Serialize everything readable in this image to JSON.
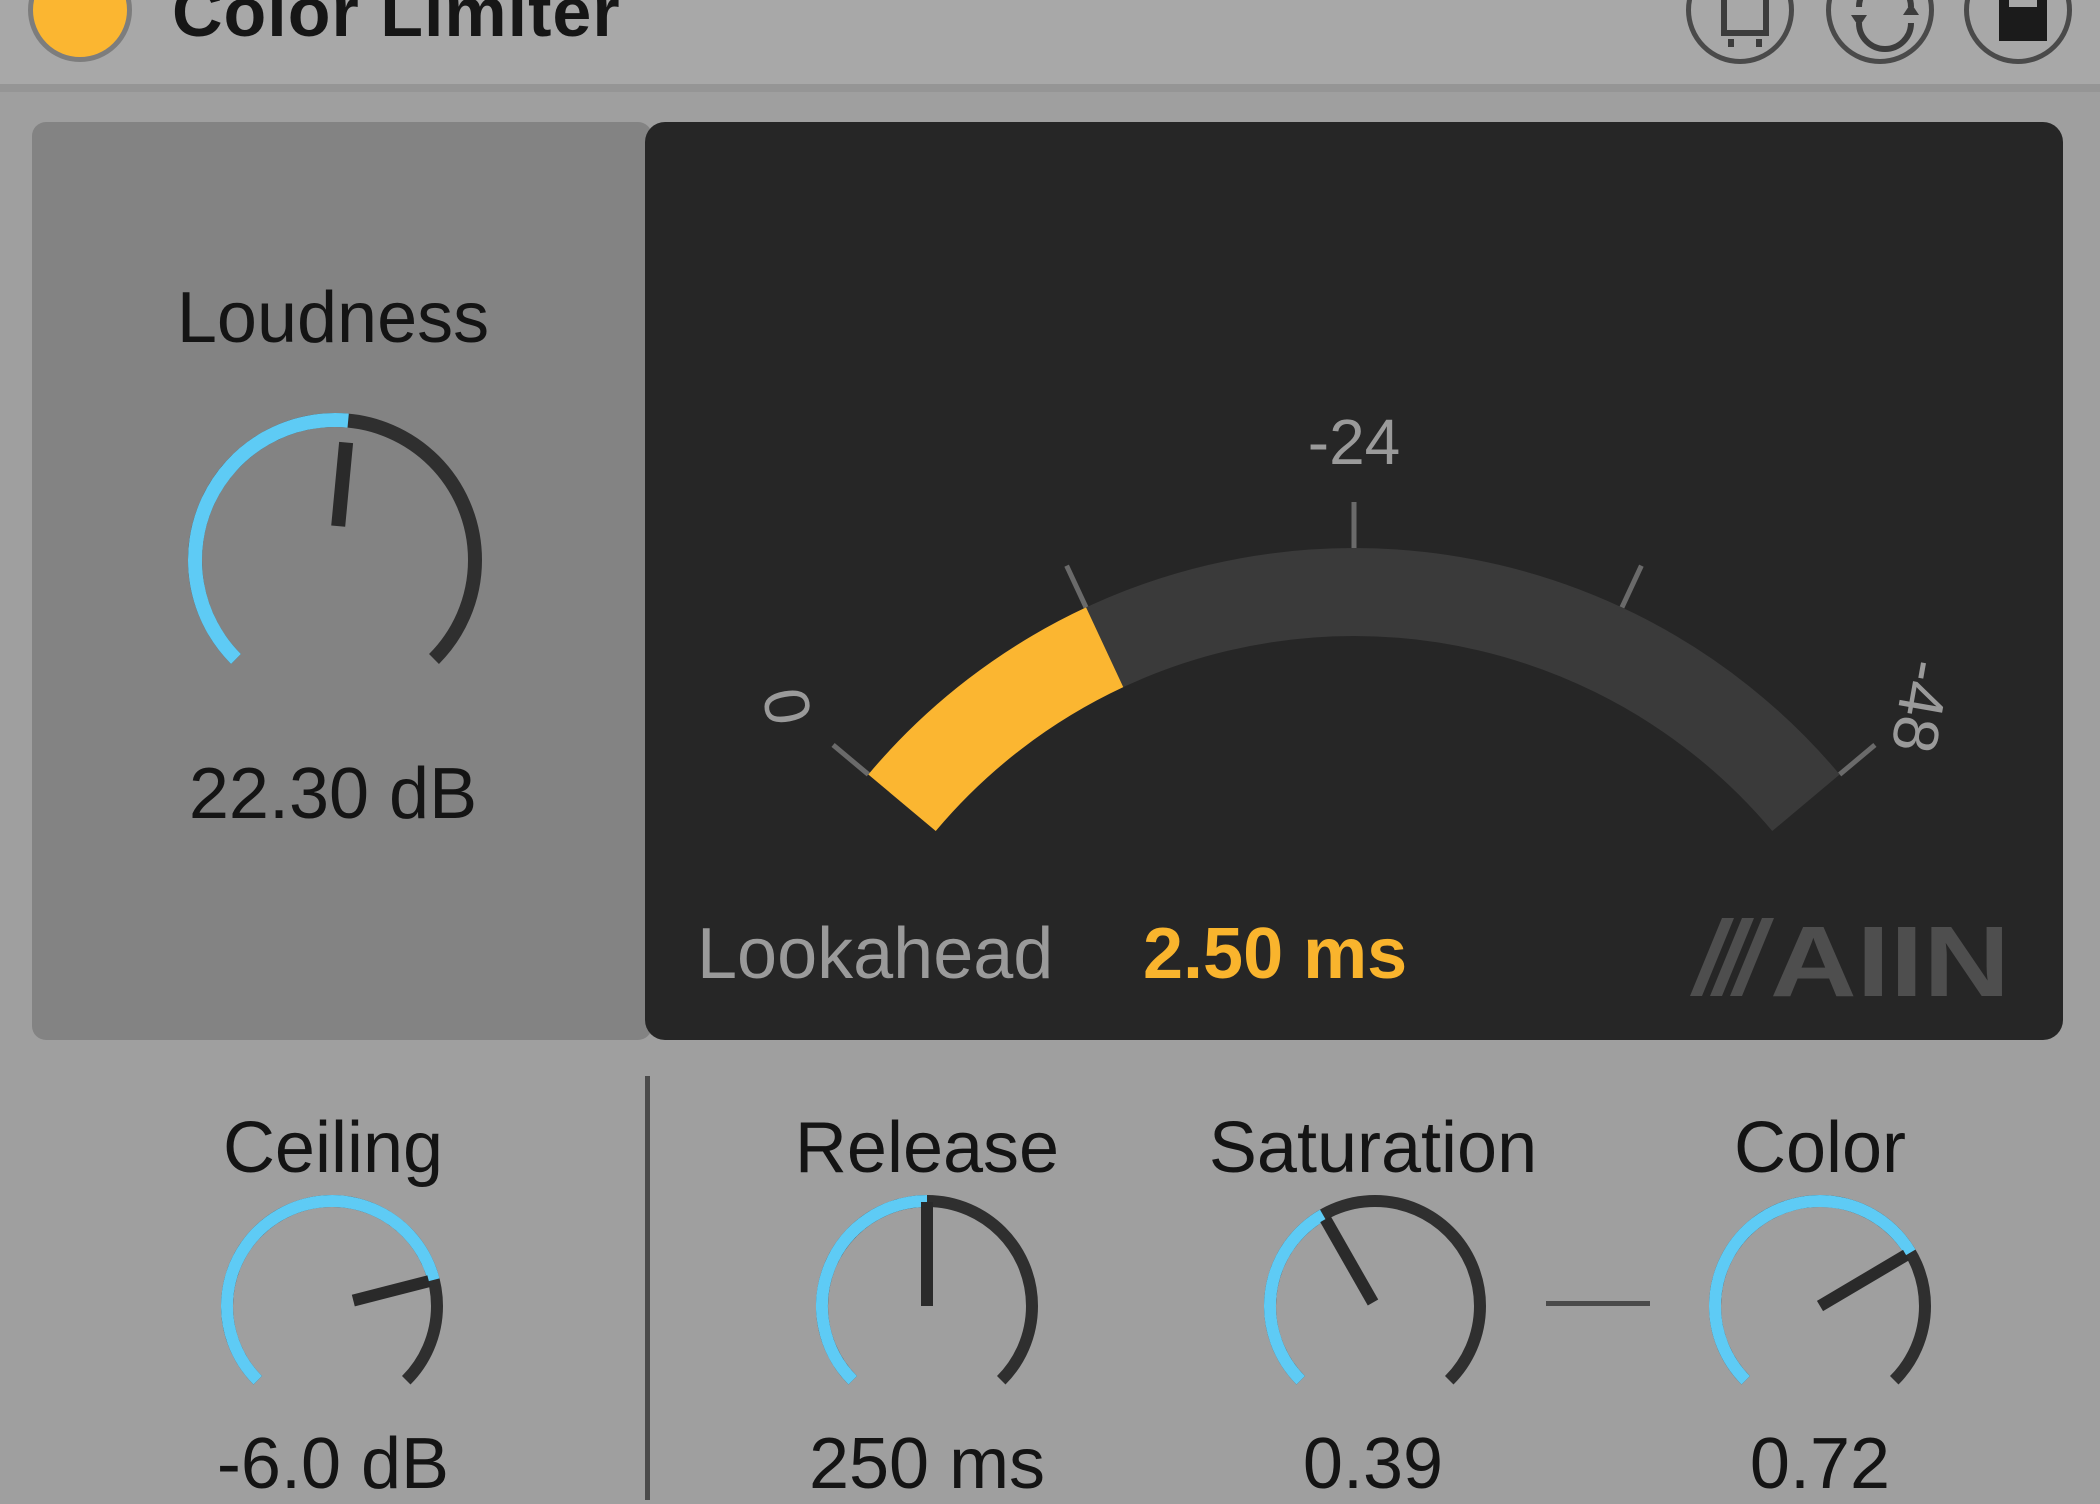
{
  "device": {
    "title": "Color Limiter",
    "power_on": true,
    "accent_color": "#fbb631",
    "knob_arc_color": "#5ecbf5",
    "header_buttons": [
      "hot-swap-icon",
      "map-icon",
      "save-preset-icon"
    ]
  },
  "loudness": {
    "label": "Loudness",
    "value": "22.30 dB",
    "level": 0.52
  },
  "meter": {
    "scale_labels": [
      "0",
      "-24",
      "-48"
    ],
    "scale_min": 0,
    "scale_max": -48,
    "gain_reduction": 0.25,
    "fill_color": "#fbb631",
    "lookahead_label": "Lookahead",
    "lookahead_value": "2.50 ms",
    "logo": "AIIN"
  },
  "controls": {
    "ceiling": {
      "label": "Ceiling",
      "value": "-6.0 dB",
      "level": 0.78
    },
    "release": {
      "label": "Release",
      "value": "250 ms",
      "level": 0.5
    },
    "saturation": {
      "label": "Saturation",
      "value": "0.39",
      "level": 0.39
    },
    "color": {
      "label": "Color",
      "value": "0.72",
      "level": 0.72
    }
  }
}
